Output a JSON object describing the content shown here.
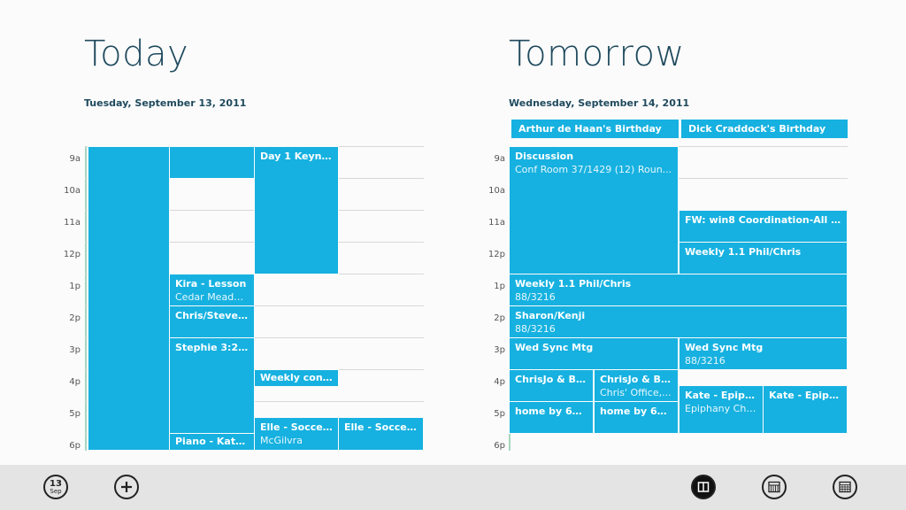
{
  "today": {
    "title": "Today",
    "date": "Tuesday, September 13, 2011",
    "hours": [
      "9a",
      "10a",
      "11a",
      "12p",
      "1p",
      "2p",
      "3p",
      "4p",
      "5p",
      "6p"
    ],
    "events": [
      {
        "title": "Day 1 Keynote",
        "sub": ""
      },
      {
        "title": "Kira - Lesson",
        "sub": "Cedar Meado..."
      },
      {
        "title": "Chris/Steven...",
        "sub": ""
      },
      {
        "title": "Stephie 3:20...",
        "sub": ""
      },
      {
        "title": "Weekly conf ca",
        "sub": ""
      },
      {
        "title": "Elle - Soccer...",
        "sub": "McGilvra"
      },
      {
        "title": "Elle - Soccer...",
        "sub": ""
      },
      {
        "title": "Piano - Kate...",
        "sub": ""
      }
    ]
  },
  "tomorrow": {
    "title": "Tomorrow",
    "date": "Wednesday, September 14, 2011",
    "hours": [
      "9a",
      "10a",
      "11a",
      "12p",
      "1p",
      "2p",
      "3p",
      "4p",
      "5p",
      "6p"
    ],
    "allday": [
      "Arthur de Haan's Birthday",
      "Dick Craddock's Birthday"
    ],
    "events": [
      {
        "title": "Discussion",
        "sub": "Conf Room 37/1429 (12) Roun..."
      },
      {
        "title": "FW: win8 Coordination-All (n...",
        "sub": ""
      },
      {
        "title": "Weekly 1.1 Phil/Chris",
        "sub": ""
      },
      {
        "title": "Weekly 1.1 Phil/Chris",
        "sub": "88/3216"
      },
      {
        "title": "Sharon/Kenji",
        "sub": "88/3216"
      },
      {
        "title": "Wed Sync Mtg",
        "sub": ""
      },
      {
        "title": "Wed Sync Mtg",
        "sub": "88/3216"
      },
      {
        "title": "ChrisJo & BH...",
        "sub": ""
      },
      {
        "title": "ChrisJo & BH...",
        "sub": "Chris' Office,..."
      },
      {
        "title": "Kate - Epipha...",
        "sub": "Epiphany Chu..."
      },
      {
        "title": "Kate - Epipha...",
        "sub": ""
      },
      {
        "title": "home by 6p...",
        "sub": ""
      },
      {
        "title": "home by 6p...",
        "sub": ""
      }
    ]
  },
  "appbar": {
    "date_day": "13",
    "date_month": "Sep",
    "icons": [
      "today-icon",
      "add-icon",
      "day-view-icon",
      "week-view-icon",
      "month-view-icon"
    ]
  }
}
